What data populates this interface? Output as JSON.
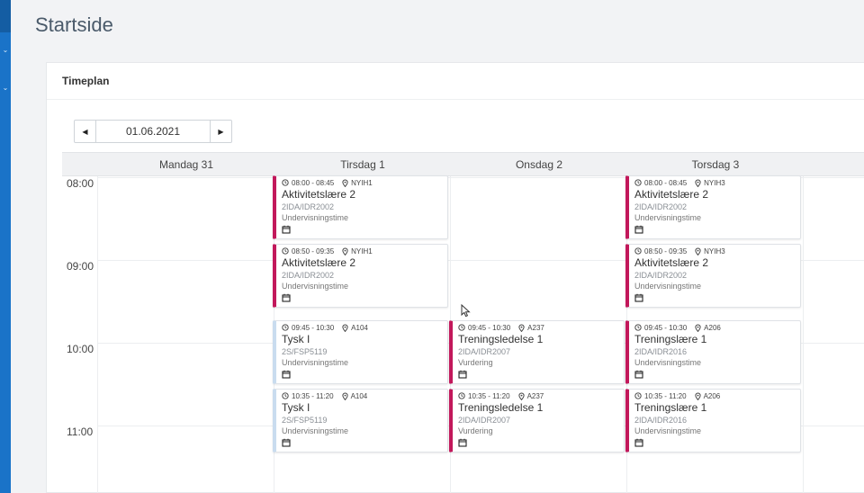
{
  "page": {
    "title": "Startside"
  },
  "panel": {
    "title": "Timeplan"
  },
  "datepicker": {
    "value": "01.06.2021"
  },
  "colors": {
    "accent": "#c2185b",
    "nav": "#1a73c8",
    "muted_bar": "#c9dcef"
  },
  "calendar": {
    "days": [
      "Mandag 31",
      "Tirsdag 1",
      "Onsdag 2",
      "Torsdag 3"
    ],
    "hours": [
      "08:00",
      "09:00",
      "10:00",
      "11:00"
    ],
    "events": [
      {
        "time": "08:00 - 08:45",
        "room": "NYIH1",
        "title": "Aktivitetslære 2",
        "code": "2IDA/IDR2002",
        "type": "Undervisningstime"
      },
      {
        "time": "08:50 - 09:35",
        "room": "NYIH1",
        "title": "Aktivitetslære 2",
        "code": "2IDA/IDR2002",
        "type": "Undervisningstime"
      },
      {
        "time": "09:45 - 10:30",
        "room": "A104",
        "title": "Tysk I",
        "code": "2S/FSP5119",
        "type": "Undervisningstime"
      },
      {
        "time": "10:35 - 11:20",
        "room": "A104",
        "title": "Tysk I",
        "code": "2S/FSP5119",
        "type": "Undervisningstime"
      },
      {
        "time": "09:45 - 10:30",
        "room": "A237",
        "title": "Treningsledelse 1",
        "code": "2IDA/IDR2007",
        "type": "Vurdering"
      },
      {
        "time": "10:35 - 11:20",
        "room": "A237",
        "title": "Treningsledelse 1",
        "code": "2IDA/IDR2007",
        "type": "Vurdering"
      },
      {
        "time": "08:00 - 08:45",
        "room": "NYIH3",
        "title": "Aktivitetslære 2",
        "code": "2IDA/IDR2002",
        "type": "Undervisningstime"
      },
      {
        "time": "08:50 - 09:35",
        "room": "NYIH3",
        "title": "Aktivitetslære 2",
        "code": "2IDA/IDR2002",
        "type": "Undervisningstime"
      },
      {
        "time": "09:45 - 10:30",
        "room": "A206",
        "title": "Treningslære 1",
        "code": "2IDA/IDR2016",
        "type": "Undervisningstime"
      },
      {
        "time": "10:35 - 11:20",
        "room": "A206",
        "title": "Treningslære 1",
        "code": "2IDA/IDR2016",
        "type": "Undervisningstime"
      }
    ]
  }
}
